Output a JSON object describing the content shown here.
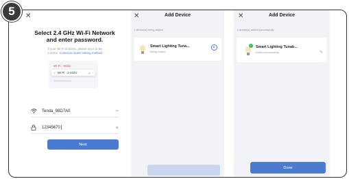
{
  "step_number": "5",
  "screen1": {
    "close_icon": "✕",
    "title_line1": "Select 2.4 GHz Wi-Fi Network",
    "title_line2": "and enter password.",
    "hint_line1": "If your Wi-Fi is 5GHz, please set it to be",
    "hint_prefix": "2.4GHz.",
    "hint_link": "Common router setting method",
    "illustration": {
      "row1_label": "Wi-Fi · 5Ghz",
      "row2_check": "✓",
      "row2_label": "Wi-Fi · 2.4Ghz"
    },
    "ssid_icon": "wifi-icon",
    "ssid_value": "Tenda_98D7A0",
    "ssid_aux": "⇆",
    "password_icon": "lock-icon",
    "password_value": "12345670",
    "password_aux": "◉",
    "next_label": "Next"
  },
  "screen2": {
    "close_icon": "✕",
    "title": "Add Device",
    "status": "1 device(s) being added",
    "device_name": "Smart Lighting Tuna...",
    "device_status": "Being added"
  },
  "screen3": {
    "close_icon": "✕",
    "title": "Add Device",
    "status": "1 device(s) added successfully",
    "device_name": "Smart Lighting Tunab...",
    "device_status": "Added successfully",
    "done_label": "Done"
  },
  "colors": {
    "accent": "#4a7bd0",
    "success": "#3fb84f",
    "screen_bg": "#f2f3f7"
  }
}
